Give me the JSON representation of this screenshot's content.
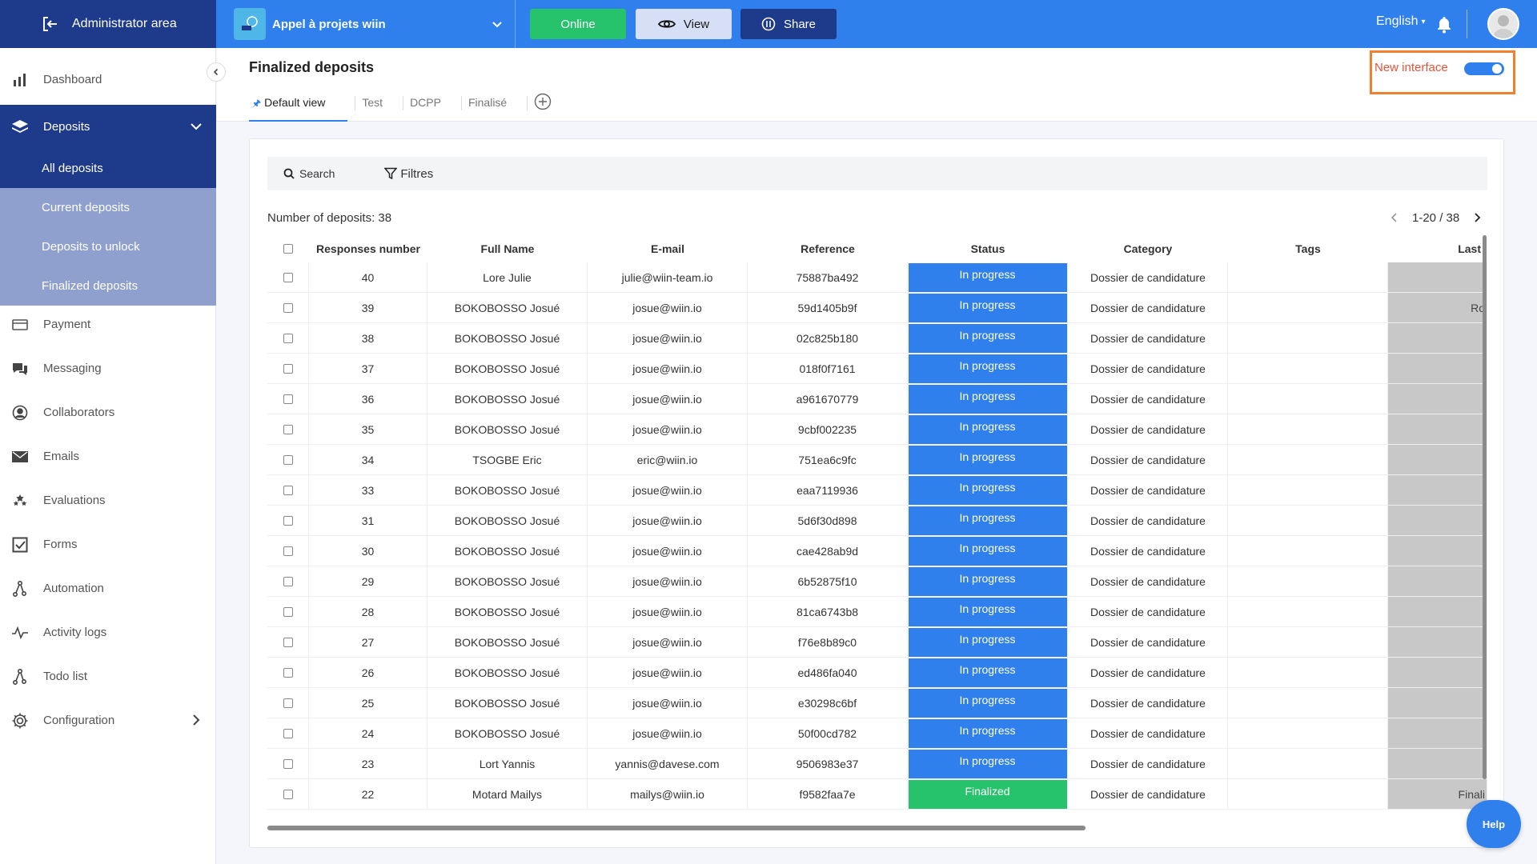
{
  "topbar": {
    "admin_label": "Administrator area",
    "project_name": "Appel à projets wiin",
    "online_label": "Online",
    "view_label": "View",
    "share_label": "Share",
    "language": "English",
    "colors": {
      "bar": "#2f80ed",
      "admin": "#1e3a8a",
      "online": "#27c26c"
    }
  },
  "sidebar": {
    "items": [
      {
        "label": "Dashboard",
        "icon": "bar-chart-icon"
      },
      {
        "label": "Deposits",
        "icon": "layers-icon"
      },
      {
        "label": "Payment",
        "icon": "credit-card-icon"
      },
      {
        "label": "Messaging",
        "icon": "chat-icon"
      },
      {
        "label": "Collaborators",
        "icon": "user-circle-icon"
      },
      {
        "label": "Emails",
        "icon": "envelope-icon"
      },
      {
        "label": "Evaluations",
        "icon": "stars-icon"
      },
      {
        "label": "Forms",
        "icon": "checkbox-icon"
      },
      {
        "label": "Automation",
        "icon": "automation-icon"
      },
      {
        "label": "Activity logs",
        "icon": "activity-icon"
      },
      {
        "label": "Todo list",
        "icon": "todo-icon"
      },
      {
        "label": "Configuration",
        "icon": "gear-icon"
      }
    ],
    "deposit_subitems": [
      {
        "label": "All deposits"
      },
      {
        "label": "Current deposits"
      },
      {
        "label": "Deposits to unlock"
      },
      {
        "label": "Finalized deposits"
      }
    ]
  },
  "page": {
    "title": "Finalized deposits",
    "tabs": [
      {
        "label": "Default view"
      },
      {
        "label": "Test"
      },
      {
        "label": "DCPP"
      },
      {
        "label": "Finalisé"
      }
    ],
    "new_interface_label": "New interface",
    "new_interface_enabled": true
  },
  "toolbar": {
    "search_label": "Search",
    "filter_label": "Filtres"
  },
  "table": {
    "count_label": "Number of deposits: 38",
    "pagination": "1-20 / 38",
    "columns": [
      "Responses number",
      "Full Name",
      "E-mail",
      "Reference",
      "Status",
      "Category",
      "Tags",
      "Last"
    ],
    "rows": [
      {
        "num": "40",
        "name": "Lore Julie",
        "email": "julie@wiin-team.io",
        "ref": "75887ba492",
        "status": "In progress",
        "category": "Dossier de candidature",
        "tags": "",
        "last": ""
      },
      {
        "num": "39",
        "name": "BOKOBOSSO Josué",
        "email": "josue@wiin.io",
        "ref": "59d1405b9f",
        "status": "In progress",
        "category": "Dossier de candidature",
        "tags": "",
        "last": "Ro"
      },
      {
        "num": "38",
        "name": "BOKOBOSSO Josué",
        "email": "josue@wiin.io",
        "ref": "02c825b180",
        "status": "In progress",
        "category": "Dossier de candidature",
        "tags": "",
        "last": ""
      },
      {
        "num": "37",
        "name": "BOKOBOSSO Josué",
        "email": "josue@wiin.io",
        "ref": "018f0f7161",
        "status": "In progress",
        "category": "Dossier de candidature",
        "tags": "",
        "last": ""
      },
      {
        "num": "36",
        "name": "BOKOBOSSO Josué",
        "email": "josue@wiin.io",
        "ref": "a961670779",
        "status": "In progress",
        "category": "Dossier de candidature",
        "tags": "",
        "last": ""
      },
      {
        "num": "35",
        "name": "BOKOBOSSO Josué",
        "email": "josue@wiin.io",
        "ref": "9cbf002235",
        "status": "In progress",
        "category": "Dossier de candidature",
        "tags": "",
        "last": ""
      },
      {
        "num": "34",
        "name": "TSOGBE Eric",
        "email": "eric@wiin.io",
        "ref": "751ea6c9fc",
        "status": "In progress",
        "category": "Dossier de candidature",
        "tags": "",
        "last": ""
      },
      {
        "num": "33",
        "name": "BOKOBOSSO Josué",
        "email": "josue@wiin.io",
        "ref": "eaa7119936",
        "status": "In progress",
        "category": "Dossier de candidature",
        "tags": "",
        "last": ""
      },
      {
        "num": "31",
        "name": "BOKOBOSSO Josué",
        "email": "josue@wiin.io",
        "ref": "5d6f30d898",
        "status": "In progress",
        "category": "Dossier de candidature",
        "tags": "",
        "last": ""
      },
      {
        "num": "30",
        "name": "BOKOBOSSO Josué",
        "email": "josue@wiin.io",
        "ref": "cae428ab9d",
        "status": "In progress",
        "category": "Dossier de candidature",
        "tags": "",
        "last": ""
      },
      {
        "num": "29",
        "name": "BOKOBOSSO Josué",
        "email": "josue@wiin.io",
        "ref": "6b52875f10",
        "status": "In progress",
        "category": "Dossier de candidature",
        "tags": "",
        "last": ""
      },
      {
        "num": "28",
        "name": "BOKOBOSSO Josué",
        "email": "josue@wiin.io",
        "ref": "81ca6743b8",
        "status": "In progress",
        "category": "Dossier de candidature",
        "tags": "",
        "last": ""
      },
      {
        "num": "27",
        "name": "BOKOBOSSO Josué",
        "email": "josue@wiin.io",
        "ref": "f76e8b89c0",
        "status": "In progress",
        "category": "Dossier de candidature",
        "tags": "",
        "last": ""
      },
      {
        "num": "26",
        "name": "BOKOBOSSO Josué",
        "email": "josue@wiin.io",
        "ref": "ed486fa040",
        "status": "In progress",
        "category": "Dossier de candidature",
        "tags": "",
        "last": ""
      },
      {
        "num": "25",
        "name": "BOKOBOSSO Josué",
        "email": "josue@wiin.io",
        "ref": "e30298c6bf",
        "status": "In progress",
        "category": "Dossier de candidature",
        "tags": "",
        "last": ""
      },
      {
        "num": "24",
        "name": "BOKOBOSSO Josué",
        "email": "josue@wiin.io",
        "ref": "50f00cd782",
        "status": "In progress",
        "category": "Dossier de candidature",
        "tags": "",
        "last": ""
      },
      {
        "num": "23",
        "name": "Lort Yannis",
        "email": "yannis@davese.com",
        "ref": "9506983e37",
        "status": "In progress",
        "category": "Dossier de candidature",
        "tags": "",
        "last": ""
      },
      {
        "num": "22",
        "name": "Motard Mailys",
        "email": "mailys@wiin.io",
        "ref": "f9582faa7e",
        "status": "Finalized",
        "category": "Dossier de candidature",
        "tags": "",
        "last": "Finali"
      }
    ]
  },
  "help_label": "Help"
}
